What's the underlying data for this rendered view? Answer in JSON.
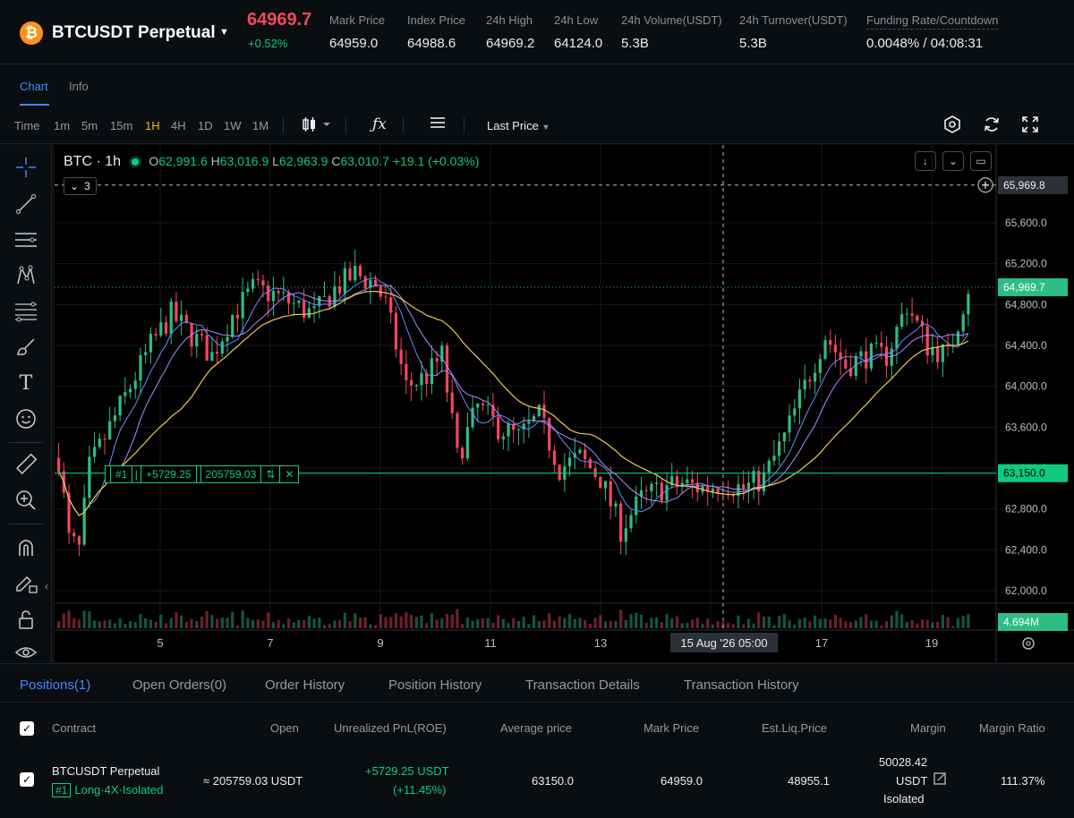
{
  "ticker": {
    "coin_glyph": "₿",
    "symbol": "BTCUSDT Perpetual",
    "last_price": "64969.7",
    "change": "+0.52%",
    "stats": [
      {
        "label": "Mark Price",
        "value": "64959.0"
      },
      {
        "label": "Index Price",
        "value": "64988.6"
      },
      {
        "label": "24h High",
        "value": "64969.2"
      },
      {
        "label": "24h Low",
        "value": "64124.0"
      },
      {
        "label": "24h Volume(USDT)",
        "value": "5.3B"
      },
      {
        "label": "24h Turnover(USDT)",
        "value": "5.3B"
      },
      {
        "label": "Funding Rate/Countdown",
        "value": "0.0048% / 04:08:31"
      }
    ]
  },
  "chart_tabs": [
    "Chart",
    "Info"
  ],
  "timeframes": {
    "label": "Time",
    "items": [
      "1m",
      "5m",
      "15m",
      "1H",
      "4H",
      "1D",
      "1W",
      "1M"
    ],
    "active": "1H",
    "price_type": "Last Price"
  },
  "chart": {
    "title": "BTC · 1h",
    "ohlc": {
      "o": "62,991.6",
      "h": "63,016.9",
      "l": "62,963.9",
      "c": "63,010.7",
      "change": "+19.1 (+0.03%)"
    },
    "alert_count": "3",
    "position_line": {
      "id": "#1",
      "pnl": "+5729.25",
      "size": "205759.03"
    },
    "price_tags": {
      "crosshair": "65,969.8",
      "last": "64,969.7",
      "entry": "63,150.0",
      "volume": "4.694M"
    },
    "crosshair_time": "15 Aug '26   05:00"
  },
  "chart_data": {
    "type": "candlestick",
    "yticks": [
      62000,
      62400,
      62800,
      63200,
      63600,
      64000,
      64400,
      64800,
      65200,
      65600
    ],
    "ytick_labels": [
      "62,000.0",
      "62,400.0",
      "62,800.0",
      "63,200.0",
      "63,600.0",
      "64,000.0",
      "64,400.0",
      "64,800.0",
      "65,200.0",
      "65,600.0"
    ],
    "xtick_labels": [
      "5",
      "7",
      "9",
      "11",
      "13",
      "17",
      "19"
    ],
    "ylim": [
      61800,
      66200
    ],
    "entry_price": 63150.0,
    "last_price": 64969.7,
    "crosshair_price": 65969.8,
    "trend_points": [
      [
        0,
        63300
      ],
      [
        2,
        62500
      ],
      [
        4,
        62400
      ],
      [
        6,
        63200
      ],
      [
        10,
        63600
      ],
      [
        14,
        64000
      ],
      [
        18,
        64400
      ],
      [
        22,
        64700
      ],
      [
        26,
        64500
      ],
      [
        30,
        64300
      ],
      [
        34,
        64700
      ],
      [
        38,
        64950
      ],
      [
        42,
        64900
      ],
      [
        46,
        64800
      ],
      [
        50,
        64700
      ],
      [
        54,
        64950
      ],
      [
        58,
        65100
      ],
      [
        62,
        65000
      ],
      [
        64,
        64800
      ],
      [
        68,
        64000
      ],
      [
        72,
        64100
      ],
      [
        75,
        64300
      ],
      [
        78,
        63300
      ],
      [
        82,
        63800
      ],
      [
        86,
        63600
      ],
      [
        90,
        63500
      ],
      [
        94,
        63700
      ],
      [
        98,
        63200
      ],
      [
        102,
        63300
      ],
      [
        106,
        63100
      ],
      [
        110,
        62600
      ],
      [
        114,
        62900
      ],
      [
        118,
        63000
      ],
      [
        122,
        63050
      ],
      [
        126,
        63000
      ],
      [
        130,
        63050
      ],
      [
        134,
        63000
      ],
      [
        138,
        63100
      ],
      [
        142,
        63500
      ],
      [
        146,
        64000
      ],
      [
        150,
        64500
      ],
      [
        154,
        64200
      ],
      [
        158,
        64300
      ],
      [
        162,
        64300
      ],
      [
        166,
        64800
      ],
      [
        170,
        64400
      ],
      [
        174,
        64300
      ],
      [
        178,
        64970
      ]
    ],
    "colors": {
      "up": "#2ebd85",
      "down": "#f6465d",
      "ma_fast": "#6c8cff",
      "ma_mid": "#b08cff",
      "ma_slow": "#f0c850",
      "entry_line": "#0ecb81"
    }
  },
  "bottom_tabs": [
    "Positions(1)",
    "Open Orders(0)",
    "Order History",
    "Position History",
    "Transaction Details",
    "Transaction History"
  ],
  "table": {
    "headers": [
      "Contract",
      "Open",
      "Unrealized PnL(ROE)",
      "Average price",
      "Mark Price",
      "Est.Liq.Price",
      "Margin",
      "Margin Ratio"
    ],
    "row": {
      "contract": "BTCUSDT Perpetual",
      "tag": "#1",
      "side": "Long·4X·Isolated",
      "open": "≈ 205759.03 USDT",
      "pnl": "+5729.25 USDT",
      "roe": "(+11.45%)",
      "avg": "63150.0",
      "mark": "64959.0",
      "liq": "48955.1",
      "margin_value": "50028.42",
      "margin_unit": "USDT",
      "margin_mode": "Isolated",
      "ratio": "111.37%"
    }
  }
}
